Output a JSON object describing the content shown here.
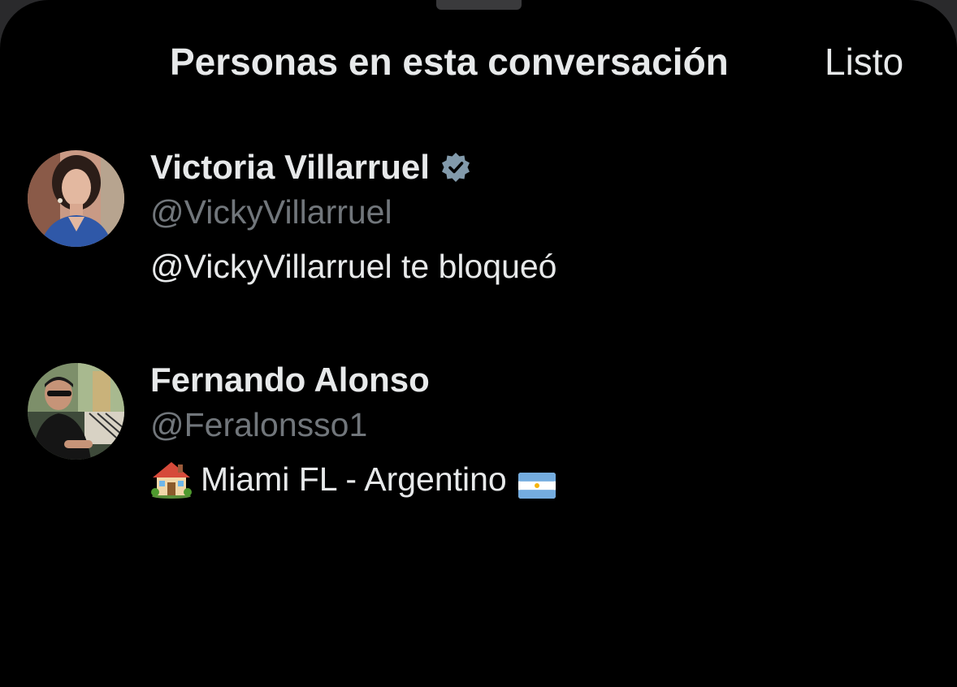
{
  "header": {
    "title": "Personas en esta conversación",
    "done_label": "Listo"
  },
  "people": [
    {
      "name": "Victoria Villarruel",
      "verified": true,
      "handle": "@VickyVillarruel",
      "bio": "@VickyVillarruel te bloqueó"
    },
    {
      "name": "Fernando Alonso",
      "verified": false,
      "handle": "@Feralonsso1",
      "bio_emoji_leading": "house-icon",
      "bio": "Miami FL - Argentino",
      "bio_emoji_trailing": "argentina-flag-icon"
    }
  ],
  "colors": {
    "background": "#000000",
    "primary_text": "#e7e9ea",
    "secondary_text": "#71767b",
    "verified_badge": "#829aab"
  }
}
